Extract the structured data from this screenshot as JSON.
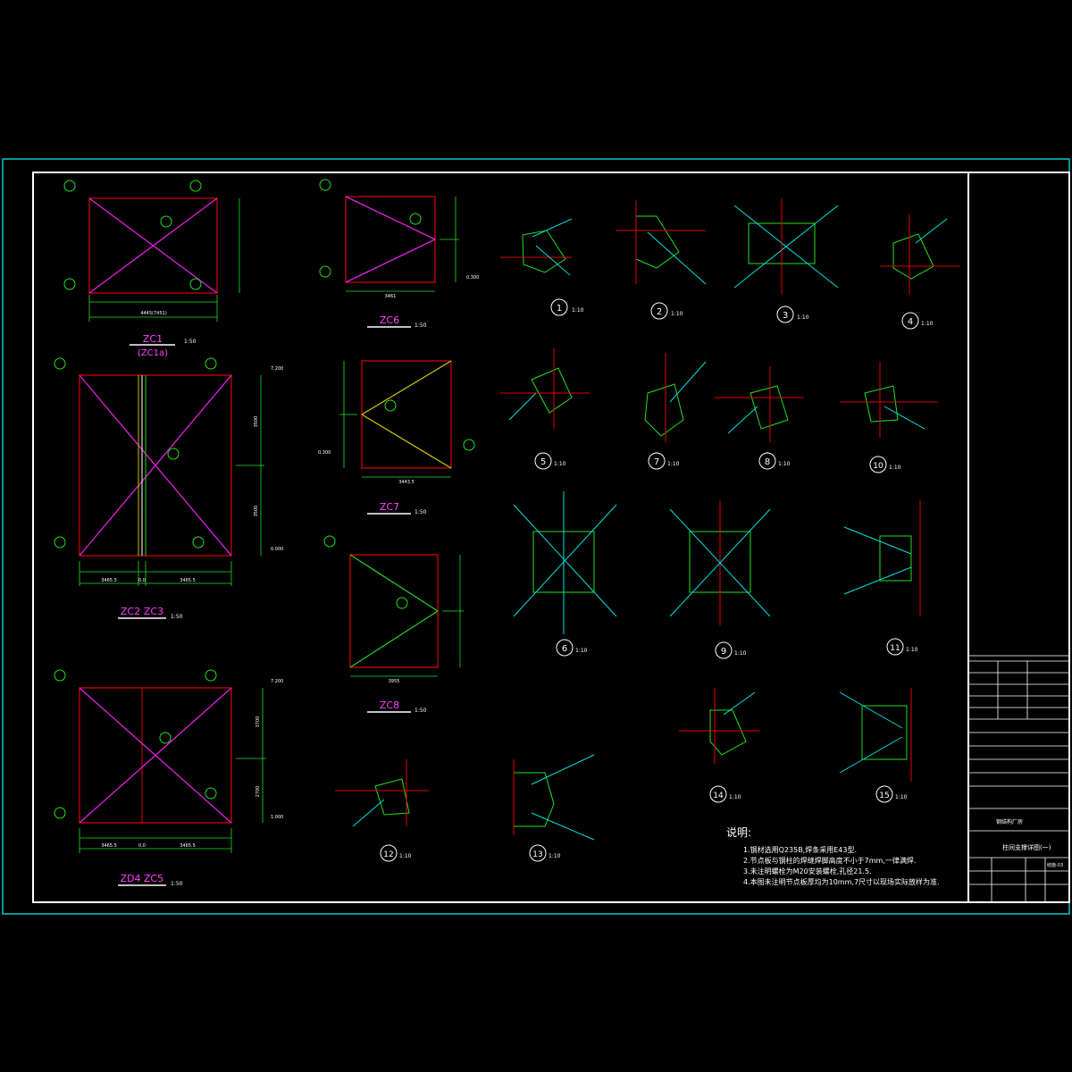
{
  "colors": {
    "background": "#000000",
    "frame": "#00c8c8",
    "inner_frame": "#ffffff",
    "member_red": "#e00000",
    "brace_magenta": "#e020e0",
    "brace_yellow": "#d0c000",
    "brace_green": "#20d020",
    "dim_green": "#20e020",
    "text_white": "#ffffff",
    "title_magenta": "#ff40ff",
    "plate_cyan": "#00e0e0"
  },
  "elevations": {
    "zc1": {
      "title": "ZC1",
      "sub": "(ZC1a)",
      "scale": "1:50",
      "dim": "4445(7451)"
    },
    "zc2": {
      "title_a": "ZC2",
      "title_b": "ZC3",
      "scale": "1:50",
      "dim_left": "3465.5",
      "dim_mid": "0.0",
      "dim_right": "3465.5",
      "dim_top": "3500",
      "dim_bottom": "3500",
      "elev_top": "7.200",
      "elev_bottom": "0.000"
    },
    "zc4": {
      "title_a": "ZD4",
      "title_b": "ZC5",
      "scale": "1:50",
      "dim_left": "3465.5",
      "dim_mid": "0.0",
      "dim_right": "3465.5",
      "dim_top": "3700",
      "dim_bottom": "2700",
      "elev_top": "7.200",
      "elev_bottom": "1.000"
    },
    "zc6": {
      "title": "ZC6",
      "scale": "1:50",
      "dim": "3461",
      "elev": "0.300"
    },
    "zc7": {
      "title": "ZC7",
      "scale": "1:50",
      "dim": "3443.5",
      "elev": "0.300"
    },
    "zc8": {
      "title": "ZC8",
      "scale": "1:50",
      "dim": "3955"
    }
  },
  "details": [
    {
      "num": "1",
      "scale": "1:10"
    },
    {
      "num": "2",
      "scale": "1:10"
    },
    {
      "num": "3",
      "scale": "1:10"
    },
    {
      "num": "4",
      "scale": "1:10"
    },
    {
      "num": "5",
      "scale": "1:10"
    },
    {
      "num": "7",
      "scale": "1:10"
    },
    {
      "num": "8",
      "scale": "1:10"
    },
    {
      "num": "10",
      "scale": "1:10"
    },
    {
      "num": "6",
      "scale": "1:10"
    },
    {
      "num": "9",
      "scale": "1:10"
    },
    {
      "num": "11",
      "scale": "1:10"
    },
    {
      "num": "14",
      "scale": "1:10"
    },
    {
      "num": "15",
      "scale": "1:10"
    },
    {
      "num": "12",
      "scale": "1:10"
    },
    {
      "num": "13",
      "scale": "1:10"
    }
  ],
  "notes": {
    "heading": "说明:",
    "lines": [
      "1.钢材选用Q235B,焊条采用E43型.",
      "2.节点板与钢柱的焊缝焊脚高度不小于7mm,一律满焊.",
      "3.未注明螺栓为M20安装螺栓,孔径21.5.",
      "4.本图未注明节点板厚均为10mm,7尺寸以现场实际放样为准."
    ]
  },
  "title_block": {
    "sheet_title": "柱间支撑详图(一)",
    "project": "钢结构厂房",
    "drawing_no": "结施-03"
  }
}
